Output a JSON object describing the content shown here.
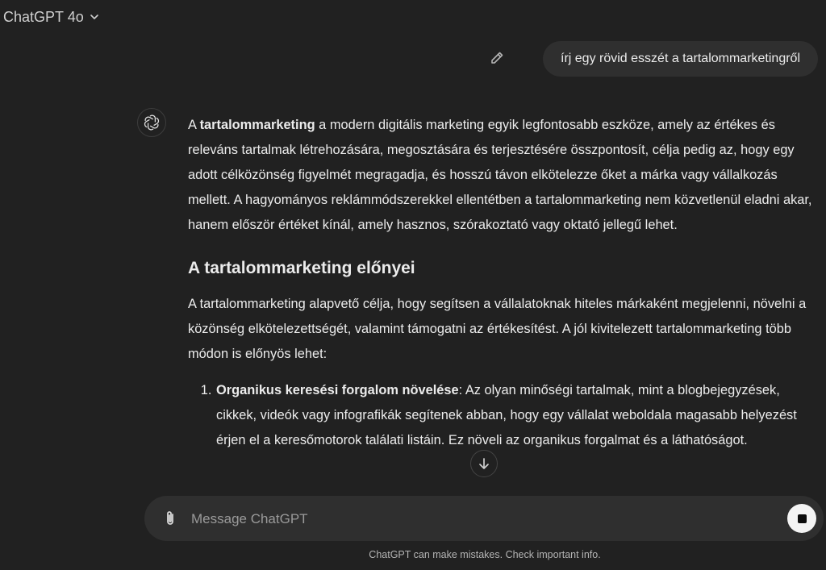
{
  "header": {
    "model_label": "ChatGPT 4o",
    "dropdown_icon": "chevron-down-icon"
  },
  "user_message": {
    "text": "írj egy rövid esszét a tartalommarketingről",
    "edit_icon": "pencil-icon"
  },
  "assistant": {
    "avatar_icon": "openai-logo-icon",
    "intro": {
      "pre": "A ",
      "bold": "tartalommarketing",
      "post": " a modern digitális marketing egyik legfontosabb eszköze, amely az értékes és releváns tartalmak létrehozására, megosztására és terjesztésére összpontosít, célja pedig az, hogy egy adott célközönség figyelmét megragadja, és hosszú távon elkötelezze őket a márka vagy vállalkozás mellett. A hagyományos reklámmódszerekkel ellentétben a tartalommarketing nem közvetlenül eladni akar, hanem először értéket kínál, amely hasznos, szórakoztató vagy oktató jellegű lehet."
    },
    "heading": "A tartalommarketing előnyei",
    "paragraph2": "A tartalommarketing alapvető célja, hogy segítsen a vállalatoknak hiteles márkaként megjelenni, növelni a közönség elkötelezettségét, valamint támogatni az értékesítést. A jól kivitelezett tartalommarketing több módon is előnyös lehet:",
    "list": [
      {
        "bold": "Organikus keresési forgalom növelése",
        "text": ": Az olyan minőségi tartalmak, mint a blogbejegyzések, cikkek, videók vagy infografikák segítenek abban, hogy egy vállalat weboldala magasabb helyezést érjen el a keresőmotorok találati listáin. Ez növeli az organikus forgalmat és a láthatóságot."
      }
    ]
  },
  "scroll_button": {
    "icon": "arrow-down-icon"
  },
  "composer": {
    "placeholder": "Message ChatGPT",
    "attach_icon": "paperclip-icon",
    "stop_icon": "stop-icon"
  },
  "footer": {
    "note": "ChatGPT can make mistakes. Check important info."
  }
}
